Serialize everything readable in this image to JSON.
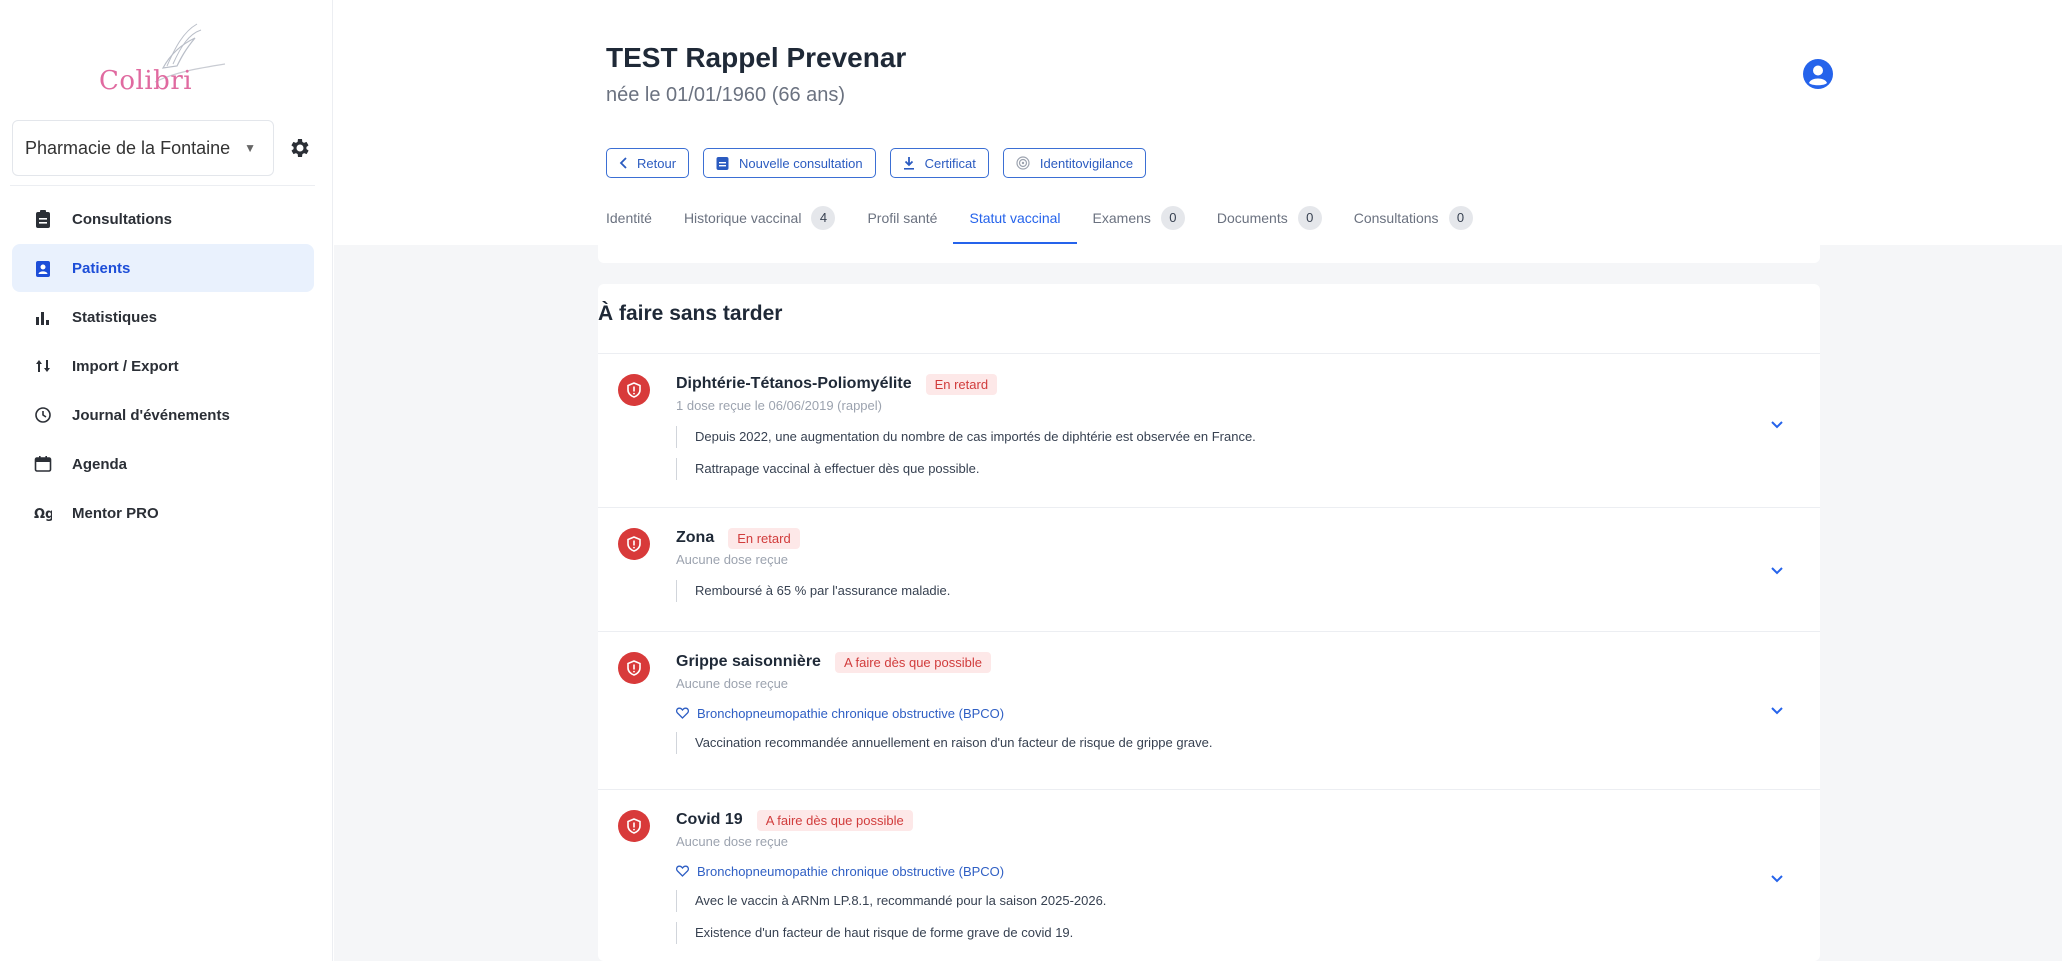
{
  "brand": {
    "name": "Colibri"
  },
  "sidebar": {
    "pharmacy": "Pharmacie de la Fontaine",
    "items": [
      {
        "label": "Consultations",
        "icon": "clipboard-icon"
      },
      {
        "label": "Patients",
        "icon": "patient-id-icon"
      },
      {
        "label": "Statistiques",
        "icon": "bar-chart-icon"
      },
      {
        "label": "Import / Export",
        "icon": "sort-arrows-icon"
      },
      {
        "label": "Journal d'événements",
        "icon": "history-icon"
      },
      {
        "label": "Agenda",
        "icon": "calendar-icon"
      },
      {
        "label": "Mentor PRO",
        "icon": "mentor-icon"
      }
    ],
    "active_index": 1
  },
  "patient": {
    "name": "TEST Rappel Prevenar",
    "dob": "née le 01/01/1960 (66 ans)"
  },
  "actions": {
    "back": "Retour",
    "new_consultation": "Nouvelle consultation",
    "certificate": "Certificat",
    "identity": "Identitovigilance"
  },
  "tabs": [
    {
      "label": "Identité",
      "count": null
    },
    {
      "label": "Historique vaccinal",
      "count": "4"
    },
    {
      "label": "Profil santé",
      "count": null
    },
    {
      "label": "Statut vaccinal",
      "count": null
    },
    {
      "label": "Examens",
      "count": "0"
    },
    {
      "label": "Documents",
      "count": "0"
    },
    {
      "label": "Consultations",
      "count": "0"
    }
  ],
  "active_tab": "Statut vaccinal",
  "section": {
    "title": "À faire sans tarder",
    "vaccines": [
      {
        "name": "Diphtérie-Tétanos-Poliomyélite",
        "status": "En retard",
        "dose": "1 dose reçue le 06/06/2019 (rappel)",
        "risk": null,
        "notes": [
          "Depuis 2022, une augmentation du nombre de cas importés de diphtérie est observée en France.",
          "Rattrapage vaccinal à effectuer dès que possible."
        ]
      },
      {
        "name": "Zona",
        "status": "En retard",
        "dose": "Aucune dose reçue",
        "risk": null,
        "notes": [
          "Remboursé à 65 % par l'assurance maladie."
        ]
      },
      {
        "name": "Grippe saisonnière",
        "status": "A faire dès que possible",
        "dose": "Aucune dose reçue",
        "risk": "Bronchopneumopathie chronique obstructive (BPCO)",
        "notes": [
          "Vaccination recommandée annuellement en raison d'un facteur de risque de grippe grave."
        ]
      },
      {
        "name": "Covid 19",
        "status": "A faire dès que possible",
        "dose": "Aucune dose reçue",
        "risk": "Bronchopneumopathie chronique obstructive (BPCO)",
        "notes": [
          "Avec le vaccin à ARNm LP.8.1, recommandé pour la saison 2025-2026.",
          "Existence d'un facteur de haut risque de forme grave de covid 19."
        ]
      }
    ]
  },
  "colors": {
    "accent": "#2563eb",
    "danger": "#d83a3a",
    "brand": "#e06aa0"
  }
}
